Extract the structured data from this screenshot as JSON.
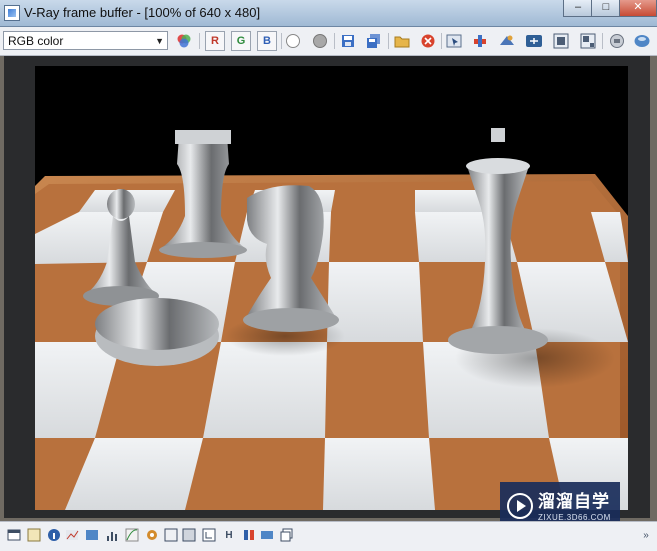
{
  "window": {
    "title": "V-Ray frame buffer - [100% of 640 x 480]",
    "buttons": [
      "–",
      "□",
      "✕"
    ]
  },
  "toolbar": {
    "channel_select": "RGB color",
    "buttons": [
      {
        "name": "color-wheel-icon"
      },
      {
        "name": "red-channel-icon",
        "label": "R",
        "color": "#c0392b"
      },
      {
        "name": "green-channel-icon",
        "label": "G",
        "color": "#2e8b3c"
      },
      {
        "name": "blue-channel-icon",
        "label": "B",
        "color": "#2f5fb5"
      },
      {
        "name": "white-circle-icon"
      },
      {
        "name": "gray-circle-icon"
      },
      {
        "name": "save-image-icon"
      },
      {
        "name": "save-all-icon"
      },
      {
        "name": "load-image-icon"
      },
      {
        "name": "clear-image-icon"
      },
      {
        "name": "track-mouse-icon"
      },
      {
        "name": "link-to-vfb-icon"
      },
      {
        "name": "region-render-icon"
      },
      {
        "name": "color-clamp-icon"
      },
      {
        "name": "render-last-icon"
      },
      {
        "name": "show-history-icon"
      },
      {
        "name": "stop-render-icon"
      },
      {
        "name": "compare-ab-icon"
      }
    ]
  },
  "statusbar": {
    "icons": [
      "toggle-panel-icon",
      "info-icon",
      "pixel-info-icon",
      "levels-icon",
      "lut-icon",
      "histogram-icon",
      "curves-icon",
      "settings-icon",
      "display-correction-icon",
      "srgb-icon",
      "history-icon",
      "h-icon",
      "compare-icon",
      "stamp-icon",
      "copy-icon",
      "expand-icon"
    ]
  },
  "watermark": {
    "title": "溜溜自学",
    "subtitle": "ZIXUE.3D66.COM"
  },
  "colors": {
    "title_bar": "#b7cbe0",
    "toolbar": "#eef0f4",
    "render_background": "#000000",
    "board_wood": "#b56a34",
    "board_light_square": "#e9ecef",
    "watermark": "#192d5a"
  }
}
